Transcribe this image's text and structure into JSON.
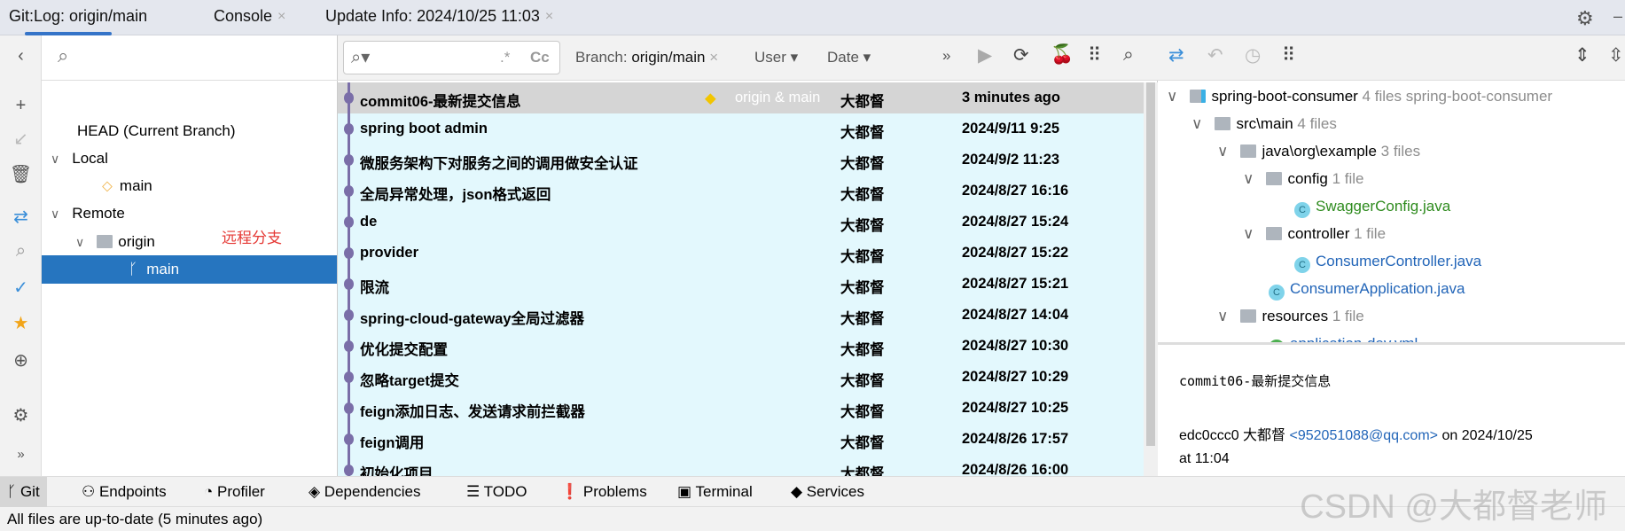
{
  "top": {
    "git_label": "Git:",
    "tabs": [
      {
        "label": "Log: origin/main"
      },
      {
        "label": "Console"
      },
      {
        "label": "Update Info: 2024/10/25 11:03"
      }
    ],
    "close": "×"
  },
  "branches": {
    "items": [
      {
        "label": "HEAD (Current Branch)"
      },
      {
        "label": "Local"
      },
      {
        "label": "main"
      },
      {
        "label": "Remote"
      },
      {
        "label": "origin"
      },
      {
        "label": "main"
      }
    ],
    "annotation": "远程分支",
    "annotation_color": "#e53935"
  },
  "log": {
    "filter": {
      "regex": ".*",
      "case": "Cc",
      "branch_prefix": "Branch: ",
      "branch": "origin/main",
      "user": "User",
      "date": "Date",
      "more": "»"
    },
    "ref_label": "origin & main",
    "commits": [
      {
        "subject": "commit06-最新提交信息",
        "author": "大都督",
        "date": "3 minutes ago"
      },
      {
        "subject": "spring boot admin",
        "author": "大都督",
        "date": "2024/9/11 9:25"
      },
      {
        "subject": "微服务架构下对服务之间的调用做安全认证",
        "author": "大都督",
        "date": "2024/9/2 11:23"
      },
      {
        "subject": "全局异常处理，json格式返回",
        "author": "大都督",
        "date": "2024/8/27 16:16"
      },
      {
        "subject": "de",
        "author": "大都督",
        "date": "2024/8/27 15:24"
      },
      {
        "subject": "provider",
        "author": "大都督",
        "date": "2024/8/27 15:22"
      },
      {
        "subject": "限流",
        "author": "大都督",
        "date": "2024/8/27 15:21"
      },
      {
        "subject": "spring-cloud-gateway全局过滤器",
        "author": "大都督",
        "date": "2024/8/27 14:04"
      },
      {
        "subject": "优化提交配置",
        "author": "大都督",
        "date": "2024/8/27 10:30"
      },
      {
        "subject": "忽略target提交",
        "author": "大都督",
        "date": "2024/8/27 10:29"
      },
      {
        "subject": "feign添加日志、发送请求前拦截器",
        "author": "大都督",
        "date": "2024/8/27 10:25"
      },
      {
        "subject": "feign调用",
        "author": "大都督",
        "date": "2024/8/26 17:57"
      },
      {
        "subject": "初始化项目",
        "author": "大都督",
        "date": "2024/8/26 16:00"
      }
    ]
  },
  "files": {
    "tree": [
      {
        "name": "spring-boot-consumer",
        "count": "4 files",
        "extra": "spring-boot-consumer"
      },
      {
        "name": "src\\main",
        "count": "4 files"
      },
      {
        "name": "java\\org\\example",
        "count": "3 files"
      },
      {
        "name": "config",
        "count": "1 file"
      },
      {
        "name": "SwaggerConfig.java"
      },
      {
        "name": "controller",
        "count": "1 file"
      },
      {
        "name": "ConsumerController.java"
      },
      {
        "name": "ConsumerApplication.java"
      },
      {
        "name": "resources",
        "count": "1 file"
      },
      {
        "name": "application-dev.yml"
      }
    ]
  },
  "details": {
    "message": "commit06-最新提交信息",
    "hash": "edc0ccc0",
    "author": "大都督",
    "email": "<952051088@qq.com>",
    "on": "on 2024/10/25",
    "at": "at 11:04"
  },
  "bottom": {
    "tabs": [
      {
        "label": "Git"
      },
      {
        "label": "Endpoints"
      },
      {
        "label": "Profiler"
      },
      {
        "label": "Dependencies"
      },
      {
        "label": "TODO"
      },
      {
        "label": "Problems"
      },
      {
        "label": "Terminal"
      },
      {
        "label": "Services"
      }
    ]
  },
  "status": {
    "text": "All files are up-to-date (5 minutes ago)"
  },
  "watermark": "CSDN @大都督老师",
  "colors": {
    "accent": "#3574c8",
    "selection": "#2675bf",
    "row_bg": "#e3f8fd",
    "graph": "#7a6ea8"
  }
}
